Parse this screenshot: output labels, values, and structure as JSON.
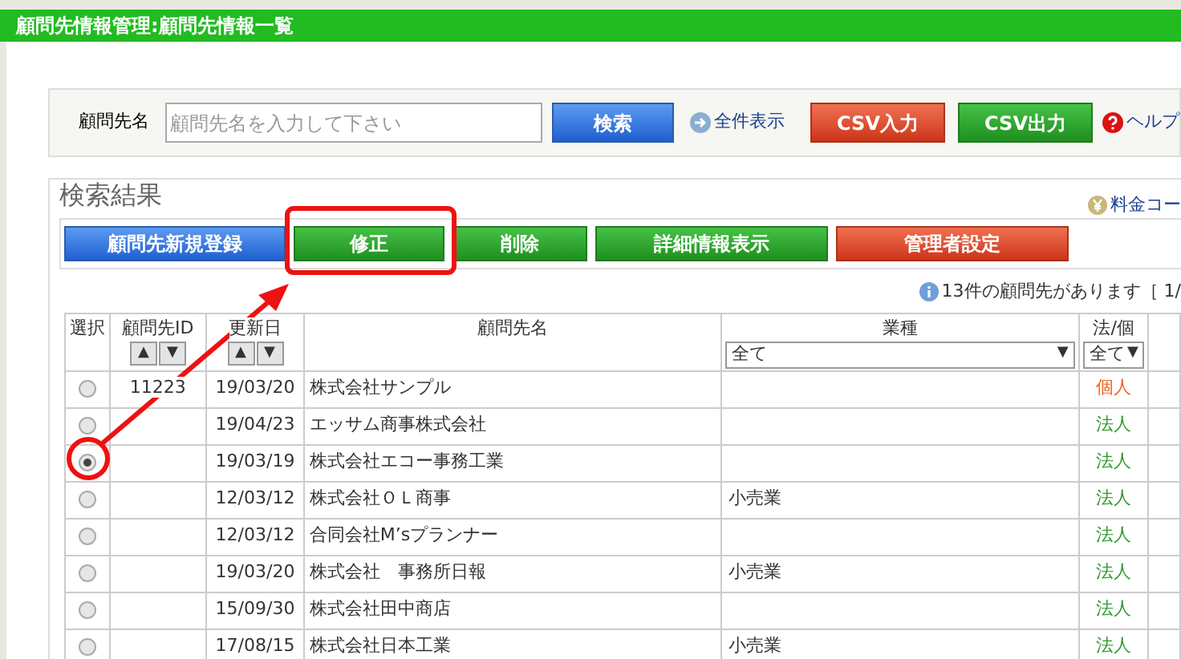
{
  "window": {
    "title": "顧問先情報管理:顧問先情報一覧"
  },
  "search": {
    "label": "顧問先名",
    "placeholder": "顧問先名を入力して下さい",
    "buttons": [
      {
        "label": "検索",
        "kind": "blue"
      }
    ],
    "show_all": "全件表示",
    "csv_buttons": [
      {
        "label": "CSV入力",
        "kind": "red"
      },
      {
        "label": "CSV出力",
        "kind": "green"
      }
    ],
    "help": "ヘルプ"
  },
  "results": {
    "title": "検索結果",
    "fee_link": "料金コー",
    "actions": [
      {
        "label": "顧問先新規登録",
        "kind": "blue"
      },
      {
        "label": "修正",
        "kind": "green"
      },
      {
        "label": "削除",
        "kind": "green"
      },
      {
        "label": "詳細情報表示",
        "kind": "green"
      },
      {
        "label": "管理者設定",
        "kind": "red"
      }
    ],
    "count": "13件の顧問先があります［ 1/"
  },
  "table": {
    "columns": [
      {
        "label": "選択"
      },
      {
        "label": "顧問先ID",
        "sort": [
          "▲",
          "▼"
        ]
      },
      {
        "label": "更新日",
        "sort": [
          "▲",
          "▼"
        ]
      },
      {
        "label": "顧問先名"
      },
      {
        "label": "業種",
        "filter": "全て",
        "caret": "▼"
      },
      {
        "label": "法/個",
        "filter": "全て",
        "caret": "▼"
      }
    ],
    "rows": [
      {
        "selected": false,
        "id": "11223",
        "date": "19/03/20",
        "name": "株式会社サンプル",
        "industry": "",
        "type": "個人",
        "color": "#f06020"
      },
      {
        "selected": false,
        "id": "",
        "date": "19/04/23",
        "name": "エッサム商事株式会社",
        "industry": "",
        "type": "法人",
        "color": "#2e9a2e"
      },
      {
        "selected": true,
        "id": "",
        "date": "19/03/19",
        "name": "株式会社エコー事務工業",
        "industry": "",
        "type": "法人",
        "color": "#2e9a2e"
      },
      {
        "selected": false,
        "id": "",
        "date": "12/03/12",
        "name": "株式会社ＯＬ商事",
        "industry": "小売業",
        "type": "法人",
        "color": "#2e9a2e"
      },
      {
        "selected": false,
        "id": "",
        "date": "12/03/12",
        "name": "合同会社M’sプランナー",
        "industry": "",
        "type": "法人",
        "color": "#2e9a2e"
      },
      {
        "selected": false,
        "id": "",
        "date": "19/03/20",
        "name": "株式会社　事務所日報",
        "industry": "小売業",
        "type": "法人",
        "color": "#2e9a2e"
      },
      {
        "selected": false,
        "id": "",
        "date": "15/09/30",
        "name": "株式会社田中商店",
        "industry": "",
        "type": "法人",
        "color": "#2e9a2e"
      },
      {
        "selected": false,
        "id": "",
        "date": "17/08/15",
        "name": "株式会社日本工業",
        "industry": "小売業",
        "type": "法人",
        "color": "#2e9a2e"
      }
    ]
  }
}
